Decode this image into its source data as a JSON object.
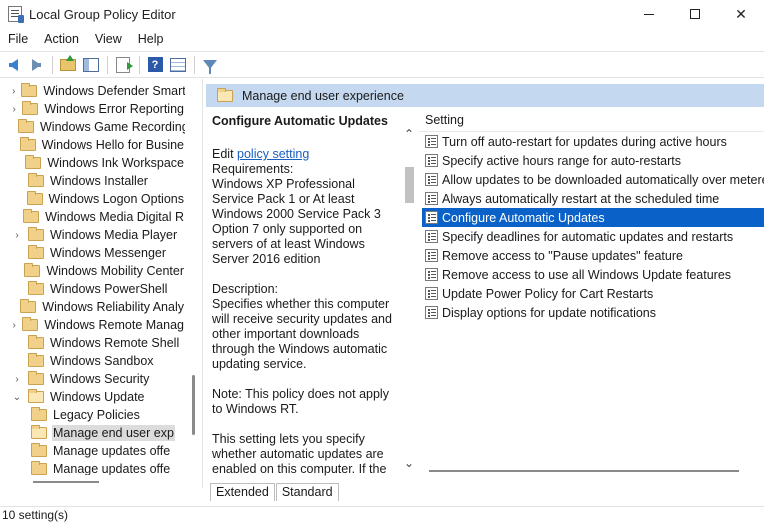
{
  "window": {
    "title": "Local Group Policy Editor",
    "minimize_glyph": "",
    "maximize_glyph": "",
    "close_glyph": "✕"
  },
  "menu": [
    "File",
    "Action",
    "View",
    "Help"
  ],
  "toolbar": {
    "icons": [
      "back-arrow-icon",
      "forward-arrow-icon",
      "up-folder-icon",
      "show-hide-tree-icon",
      "export-list-icon",
      "help-icon",
      "view-icon",
      "filter-icon"
    ],
    "help_glyph": "?"
  },
  "tree": {
    "items": [
      {
        "label": "Windows Defender Smart",
        "chevron": "›",
        "open": false
      },
      {
        "label": "Windows Error Reporting",
        "chevron": "›",
        "open": false
      },
      {
        "label": "Windows Game Recording",
        "chevron": "",
        "open": false
      },
      {
        "label": "Windows Hello for Busine",
        "chevron": "",
        "open": false
      },
      {
        "label": "Windows Ink Workspace",
        "chevron": "",
        "open": false
      },
      {
        "label": "Windows Installer",
        "chevron": "",
        "open": false
      },
      {
        "label": "Windows Logon Options",
        "chevron": "",
        "open": false
      },
      {
        "label": "Windows Media Digital R",
        "chevron": "",
        "open": false
      },
      {
        "label": "Windows Media Player",
        "chevron": "›",
        "open": false
      },
      {
        "label": "Windows Messenger",
        "chevron": "",
        "open": false
      },
      {
        "label": "Windows Mobility Center",
        "chevron": "",
        "open": false
      },
      {
        "label": "Windows PowerShell",
        "chevron": "",
        "open": false
      },
      {
        "label": "Windows Reliability Analy",
        "chevron": "",
        "open": false
      },
      {
        "label": "Windows Remote Manag",
        "chevron": "›",
        "open": false
      },
      {
        "label": "Windows Remote Shell",
        "chevron": "",
        "open": false
      },
      {
        "label": "Windows Sandbox",
        "chevron": "",
        "open": false
      },
      {
        "label": "Windows Security",
        "chevron": "›",
        "open": false
      },
      {
        "label": "Windows Update",
        "chevron": "⌄",
        "open": true
      },
      {
        "label": "Legacy Policies",
        "chevron": "",
        "open": false
      },
      {
        "label": "Manage end user exp",
        "chevron": "",
        "open": true
      },
      {
        "label": "Manage updates offe",
        "chevron": "",
        "open": false
      },
      {
        "label": "Manage updates offe",
        "chevron": "",
        "open": false
      }
    ]
  },
  "pane": {
    "header": "Manage end user experience",
    "description": {
      "title": "Configure Automatic Updates",
      "edit_prefix": "Edit ",
      "edit_link": "policy setting",
      "body": "\nRequirements:\nWindows XP Professional Service Pack 1 or At least Windows 2000 Service Pack 3 Option 7 only supported on servers of at least Windows Server 2016 edition\n\nDescription:\nSpecifies whether this computer will receive security updates and other important downloads through the Windows automatic updating service.\n\nNote: This policy does not apply to Windows RT.\n\nThis setting lets you specify whether automatic updates are enabled on this computer. If the"
    },
    "list_header": "Setting",
    "settings": [
      "Turn off auto-restart for updates during active hours",
      "Specify active hours range for auto-restarts",
      "Allow updates to be downloaded automatically over metere...",
      "Always automatically restart at the scheduled time",
      "Configure Automatic Updates",
      "Specify deadlines for automatic updates and restarts",
      "Remove access to \"Pause updates\" feature",
      "Remove access to use all Windows Update features",
      "Update Power Policy for Cart Restarts",
      "Display options for update notifications"
    ],
    "selected_index": 4,
    "tabs": [
      "Extended",
      "Standard"
    ],
    "scroll_up": "⌃",
    "scroll_down": "⌄"
  },
  "status": "10 setting(s)",
  "colors": {
    "header_bg": "#c4d9ef",
    "selection": "#0a62c8",
    "link": "#1a5fc0"
  }
}
